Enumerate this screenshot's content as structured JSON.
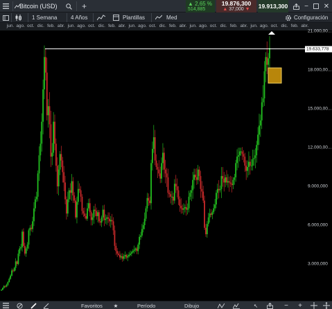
{
  "header": {
    "app_title": "Bitcoin (USD)",
    "change_pct": "2,65 %",
    "change_abs": "514,885",
    "sell_price": "19.876,300",
    "spread": "37,000",
    "buy_price": "19.913,300"
  },
  "toolbar": {
    "interval": "1 Semana",
    "range": "4 Años",
    "templates": "Plantillas",
    "indicator": "Med",
    "settings": "Configuración"
  },
  "x_axis_months": [
    "jun.",
    "ago.",
    "oct.",
    "dic.",
    "feb.",
    "abr.",
    "jun.",
    "ago.",
    "oct.",
    "dic.",
    "feb.",
    "abr.",
    "jun.",
    "ago.",
    "oct.",
    "dic.",
    "feb.",
    "abr.",
    "jun.",
    "ago.",
    "oct.",
    "dic.",
    "feb.",
    "abr.",
    "jun.",
    "ago.",
    "oct.",
    "dic.",
    "feb.",
    "abr."
  ],
  "y_axis_labels": [
    "21.000,00...",
    "18.000,00...",
    "15.000,00...",
    "12.000,00...",
    "9.000,000",
    "6.000,000",
    "3.000,000"
  ],
  "current_price_label": "19.633,778",
  "bottom": {
    "favorites": "Favoritos",
    "period": "Período",
    "drawing": "Dibujo"
  },
  "colors": {
    "up": "#22c01f",
    "down": "#c92a2a",
    "price_line": "#ffffff",
    "marker_fill": "#b8860b"
  },
  "chart_data": {
    "type": "candlestick",
    "y_range": [
      0,
      21000
    ],
    "y_ticks": [
      3000,
      6000,
      9000,
      12000,
      15000,
      18000,
      21000
    ],
    "current_price": 19633.778,
    "close": [
      1000,
      1150,
      1300,
      1250,
      1400,
      1600,
      1850,
      2100,
      2500,
      2450,
      2700,
      3200,
      3000,
      3800,
      4200,
      4300,
      5500,
      4400,
      3800,
      4200,
      4500,
      5600,
      5800,
      5700,
      6300,
      7300,
      8000,
      8200,
      10000,
      11400,
      12300,
      14000,
      16500,
      19000,
      17800,
      14500,
      15200,
      13800,
      11300,
      11600,
      14000,
      12300,
      10600,
      9000,
      10300,
      11500,
      11000,
      10100,
      9300,
      8000,
      6900,
      8000,
      8700,
      8500,
      9400,
      8300,
      7900,
      6600,
      7800,
      8800,
      8700,
      8200,
      7100,
      6900,
      6700,
      6500,
      7300,
      7700,
      7000,
      6400,
      6600,
      7200,
      7100,
      6700,
      7000,
      6300,
      6200,
      6600,
      7200,
      6400,
      6500,
      6600,
      6500,
      6300,
      6400,
      6300,
      5600,
      4400,
      4000,
      3800,
      3700,
      3500,
      3600,
      3400,
      3600,
      3700,
      3500,
      3600,
      3700,
      3800,
      3900,
      4000,
      4100,
      4200,
      4000,
      4500,
      5100,
      5200,
      5700,
      6000,
      6500,
      7300,
      8100,
      7900,
      7700,
      10800,
      11900,
      12800,
      11000,
      10500,
      10300,
      10000,
      9600,
      10800,
      11600,
      10300,
      10000,
      9700,
      8500,
      8400,
      8200,
      8200,
      7900,
      9200,
      9000,
      8700,
      8000,
      7500,
      7300,
      7200,
      7300,
      7400,
      7200,
      7300,
      8200,
      8500,
      8700,
      9500,
      9900,
      9700,
      9500,
      10300,
      9800,
      8800,
      8600,
      7900,
      5800,
      5300,
      6100,
      6600,
      6900,
      6800,
      7000,
      7300,
      7600,
      8500,
      8800,
      8700,
      8800,
      9800,
      9600,
      9300,
      9700,
      9300,
      9400,
      9300,
      9200,
      9100,
      9500,
      9700,
      10800,
      11300,
      11400,
      11700,
      11700,
      11500,
      11300,
      10600,
      10200,
      10500,
      10900,
      10600,
      10600,
      11100,
      11200,
      11400,
      12200,
      13000,
      13700,
      14100,
      15500,
      15800,
      17900,
      19000,
      18400,
      18900,
      19700
    ]
  }
}
